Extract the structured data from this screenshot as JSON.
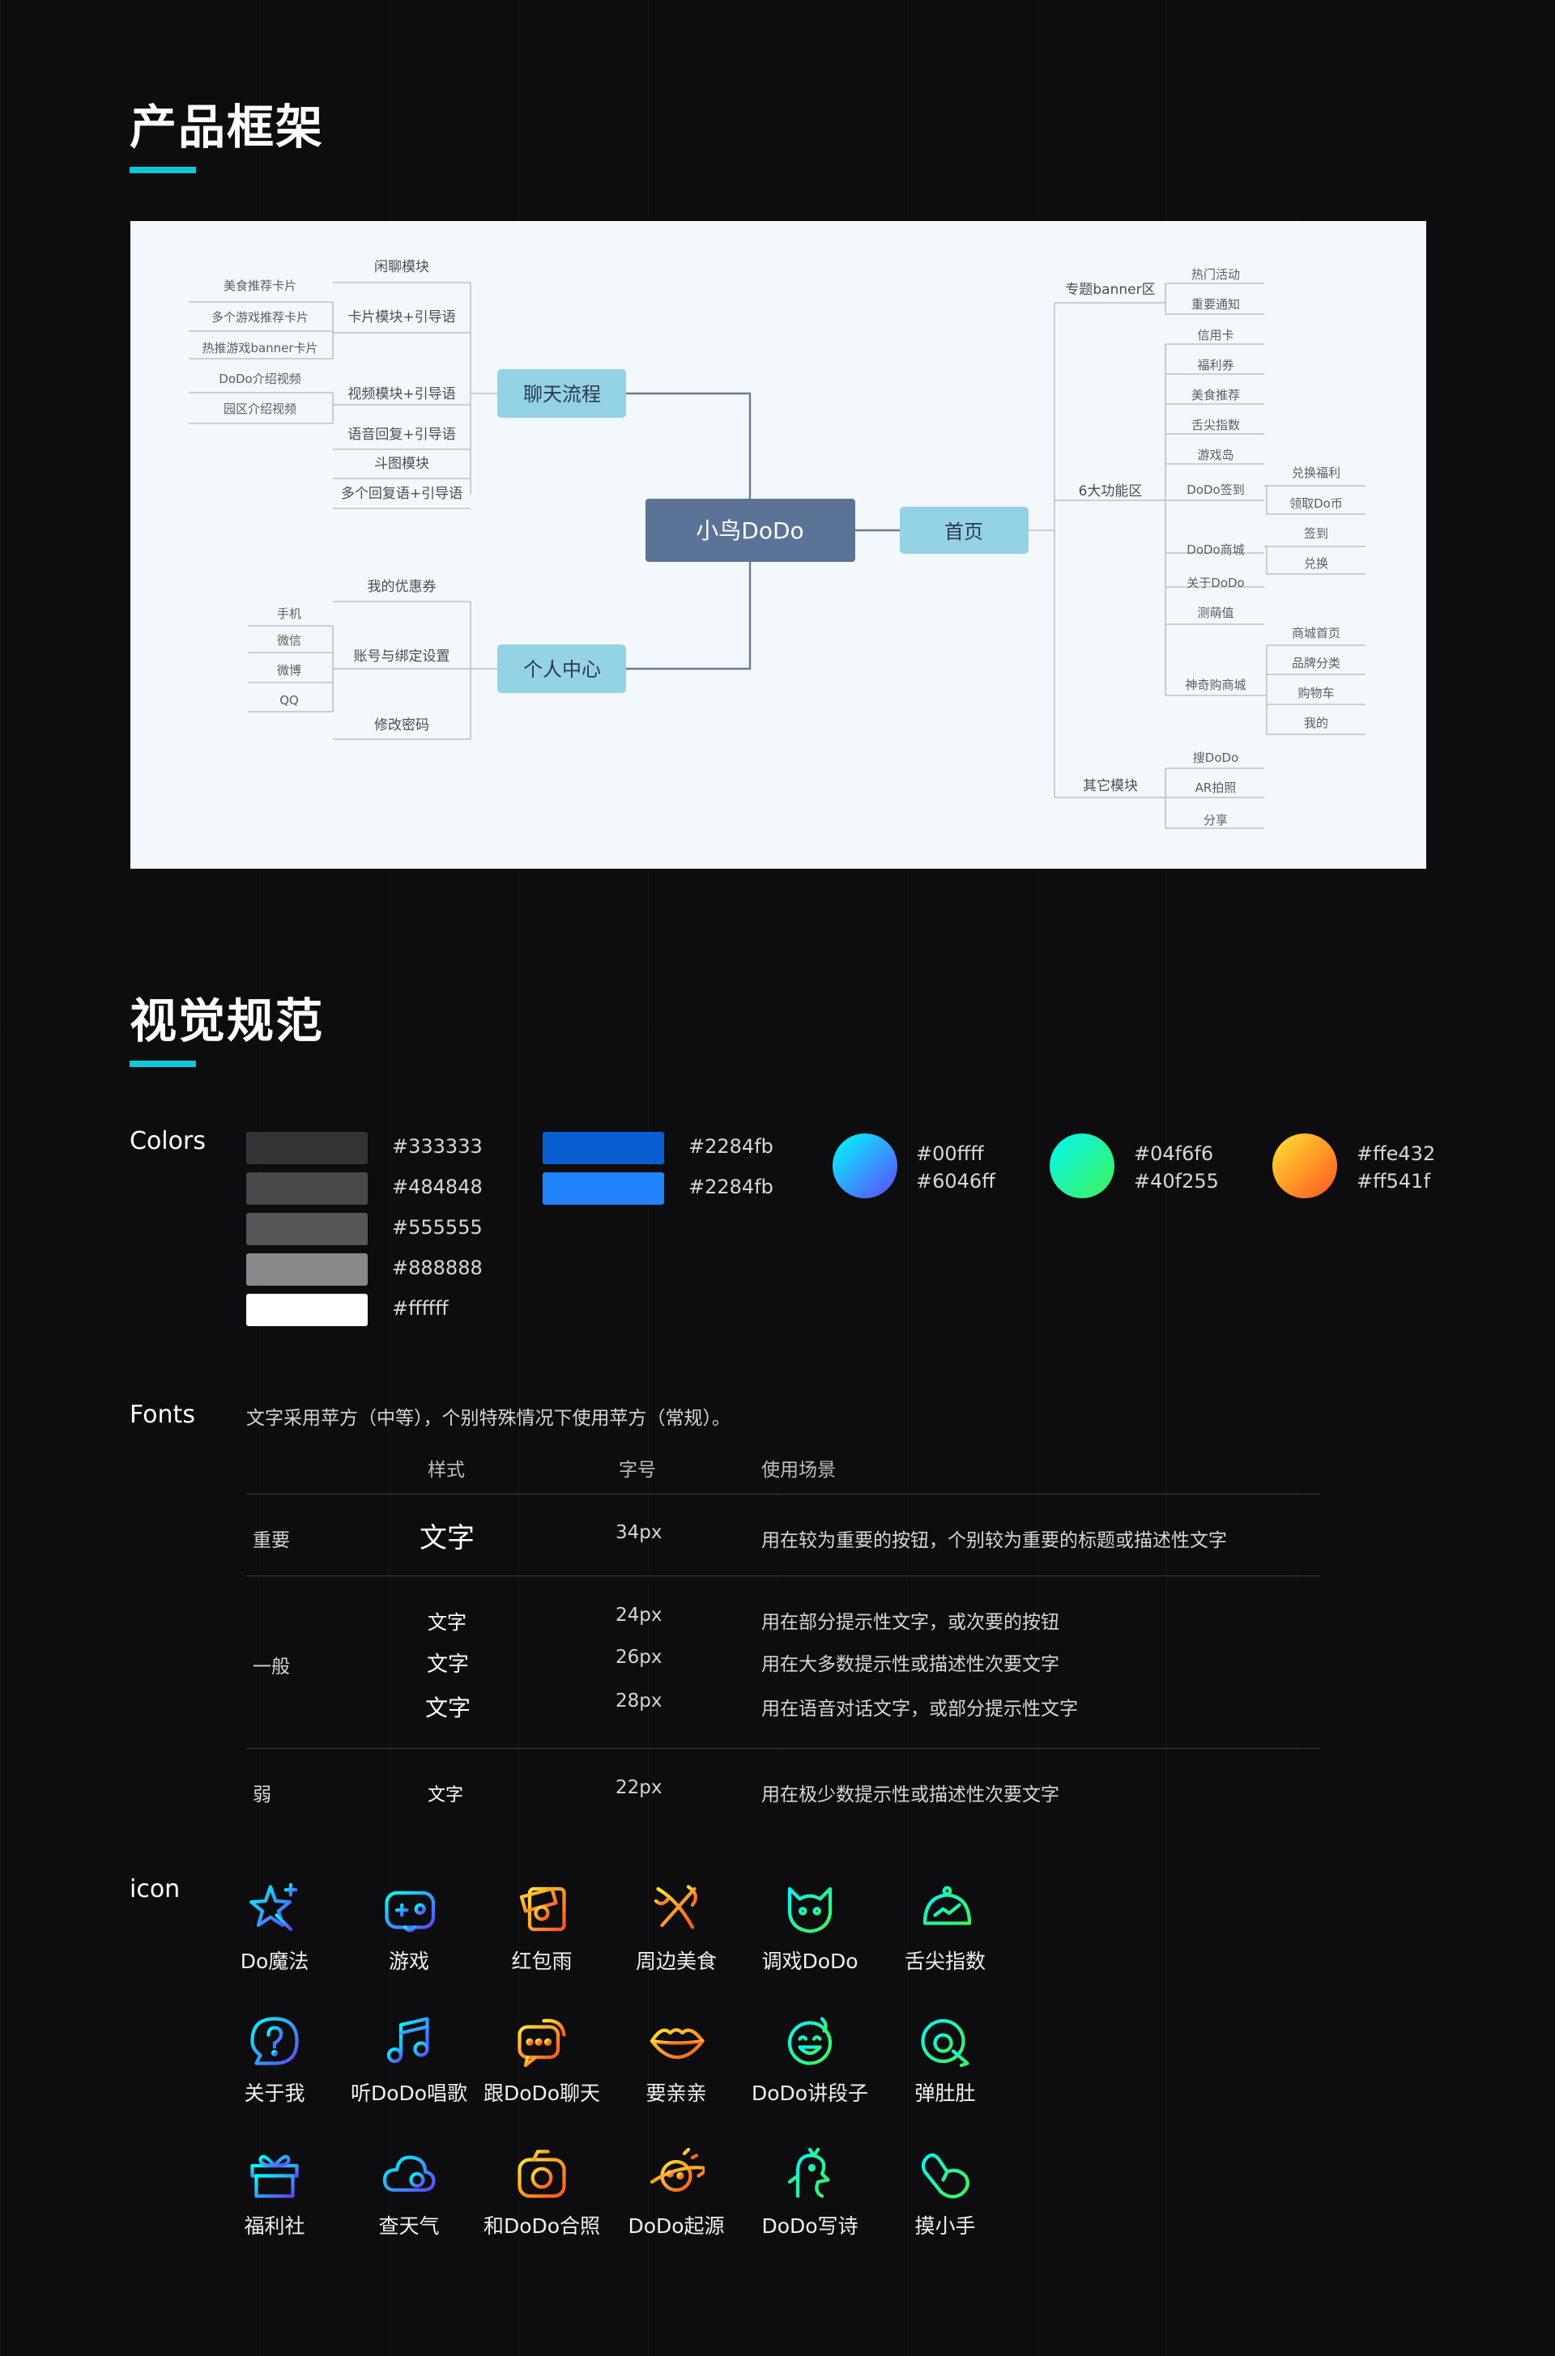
{
  "sections": {
    "framework_title": "产品框架",
    "visual_title": "视觉规范"
  },
  "mindmap": {
    "root": "小鸟DoDo",
    "chat": {
      "label": "聊天流程",
      "branches": [
        "闲聊模块",
        "卡片模块+引导语",
        "视频模块+引导语",
        "语音回复+引导语",
        "斗图模块",
        "多个回复语+引导语"
      ],
      "card_leaves": [
        "美食推荐卡片",
        "多个游戏推荐卡片",
        "热推游戏banner卡片"
      ],
      "video_leaves": [
        "DoDo介绍视频",
        "园区介绍视频"
      ]
    },
    "personal": {
      "label": "个人中心",
      "branches": [
        "我的优惠券",
        "账号与绑定设置",
        "修改密码"
      ],
      "account_leaves": [
        "手机",
        "微信",
        "微博",
        "QQ"
      ]
    },
    "home": {
      "label": "首页",
      "branches": [
        "专题banner区",
        "6大功能区",
        "其它模块"
      ],
      "banner_leaves": [
        "热门活动",
        "重要通知"
      ],
      "func_leaves": [
        "信用卡",
        "福利券",
        "美食推荐",
        "舌尖指数",
        "游戏岛",
        "DoDo签到",
        "DoDo商城",
        "关于DoDo",
        "测萌值",
        "神奇购商城"
      ],
      "signin_leaves": [
        "兑换福利",
        "领取Do币"
      ],
      "mall_leaves": [
        "签到",
        "兑换"
      ],
      "shop_leaves": [
        "商城首页",
        "品牌分类",
        "购物车",
        "我的"
      ],
      "other_leaves": [
        "搜DoDo",
        "AR拍照",
        "分享"
      ]
    }
  },
  "colors": {
    "label": "Colors",
    "grays": [
      {
        "hex": "#333333",
        "color": "#333333"
      },
      {
        "hex": "#484848",
        "color": "#484848"
      },
      {
        "hex": "#555555",
        "color": "#555555"
      },
      {
        "hex": "#888888",
        "color": "#888888"
      },
      {
        "hex": "#ffffff",
        "color": "#ffffff"
      }
    ],
    "blues": [
      {
        "hex": "#2284fb",
        "color": "#0a5fd0"
      },
      {
        "hex": "#2284fb",
        "color": "#2284fb"
      }
    ],
    "gradients": [
      {
        "from": "#00ffff",
        "to": "#6046ff"
      },
      {
        "from": "#04f6f6",
        "to": "#40f255"
      },
      {
        "from": "#ffe432",
        "to": "#ff541f"
      }
    ]
  },
  "fonts": {
    "label": "Fonts",
    "description": "文字采用苹方（中等），个别特殊情况下使用苹方（常规）。",
    "headers": [
      "样式",
      "字号",
      "使用场景"
    ],
    "rows": [
      {
        "level": "重要",
        "sample": "文字",
        "size": "34px",
        "usage": "用在较为重要的按钮，个别较为重要的标题或描述性文字"
      },
      {
        "level": "一般",
        "sample": "文字",
        "size": "24px",
        "usage": "用在部分提示性文字，或次要的按钮"
      },
      {
        "level": "",
        "sample": "文字",
        "size": "26px",
        "usage": "用在大多数提示性或描述性次要文字"
      },
      {
        "level": "",
        "sample": "文字",
        "size": "28px",
        "usage": "用在语音对话文字，或部分提示性文字"
      },
      {
        "level": "弱",
        "sample": "文字",
        "size": "22px",
        "usage": "用在极少数提示性或描述性次要文字"
      }
    ]
  },
  "icons": {
    "label": "icon",
    "items": [
      {
        "label": "Do魔法",
        "icon": "magic-star-icon",
        "g": "blue"
      },
      {
        "label": "游戏",
        "icon": "gamepad-icon",
        "g": "blue"
      },
      {
        "label": "红包雨",
        "icon": "red-packet-icon",
        "g": "orange"
      },
      {
        "label": "周边美食",
        "icon": "fork-knife-icon",
        "g": "orange"
      },
      {
        "label": "调戏DoDo",
        "icon": "cat-face-icon",
        "g": "green"
      },
      {
        "label": "舌尖指数",
        "icon": "dish-cover-icon",
        "g": "green"
      },
      {
        "label": "关于我",
        "icon": "question-bubble-icon",
        "g": "blue"
      },
      {
        "label": "听DoDo唱歌",
        "icon": "music-note-icon",
        "g": "blue"
      },
      {
        "label": "跟DoDo聊天",
        "icon": "chat-bubble-icon",
        "g": "orange"
      },
      {
        "label": "要亲亲",
        "icon": "lips-icon",
        "g": "orange"
      },
      {
        "label": "DoDo讲段子",
        "icon": "laughing-face-icon",
        "g": "green"
      },
      {
        "label": "弹肚肚",
        "icon": "poke-belly-icon",
        "g": "green"
      },
      {
        "label": "福利社",
        "icon": "gift-icon",
        "g": "blue"
      },
      {
        "label": "查天气",
        "icon": "weather-cloud-icon",
        "g": "blue"
      },
      {
        "label": "和DoDo合照",
        "icon": "camera-icon",
        "g": "orange"
      },
      {
        "label": "DoDo起源",
        "icon": "planet-icon",
        "g": "orange"
      },
      {
        "label": "DoDo写诗",
        "icon": "bird-poet-icon",
        "g": "green"
      },
      {
        "label": "摸小手",
        "icon": "hand-icon",
        "g": "green"
      }
    ]
  }
}
